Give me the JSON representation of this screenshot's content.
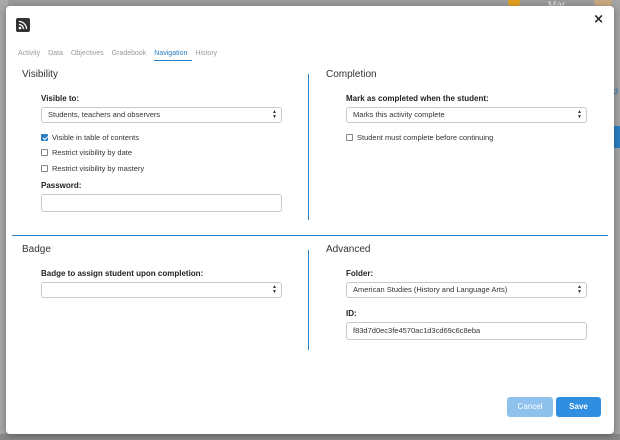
{
  "background": {
    "user_name": "Mar",
    "right_link": "d",
    "accent_color": "#2b7fc5"
  },
  "modal": {
    "close_symbol": "×",
    "icon": "rss-icon"
  },
  "tabs": [
    {
      "label": "Activity",
      "active": false
    },
    {
      "label": "Data",
      "active": false
    },
    {
      "label": "Objectives",
      "active": false
    },
    {
      "label": "Gradebook",
      "active": false
    },
    {
      "label": "Navigation",
      "active": true
    },
    {
      "label": "History",
      "active": false
    }
  ],
  "visibility": {
    "title": "Visibility",
    "visible_to_label": "Visible to:",
    "visible_to_value": "Students, teachers and observers",
    "checkboxes": [
      {
        "label": "Visible in table of contents",
        "checked": true
      },
      {
        "label": "Restrict visibility by date",
        "checked": false
      },
      {
        "label": "Restrict visibility by mastery",
        "checked": false
      }
    ],
    "password_label": "Password:",
    "password_value": ""
  },
  "completion": {
    "title": "Completion",
    "mark_label": "Mark as completed when the student:",
    "mark_value": "Marks this activity complete",
    "checkbox_label": "Student must complete before continuing",
    "checkbox_checked": false
  },
  "badge": {
    "title": "Badge",
    "assign_label": "Badge to assign student upon completion:",
    "assign_value": ""
  },
  "advanced": {
    "title": "Advanced",
    "folder_label": "Folder:",
    "folder_value": "American Studies (History and Language Arts)",
    "id_label": "ID:",
    "id_value": "f83d7d0ec3fe4570ac1d3cd69c6c8eba"
  },
  "footer": {
    "cancel_label": "Cancel",
    "save_label": "Save"
  }
}
